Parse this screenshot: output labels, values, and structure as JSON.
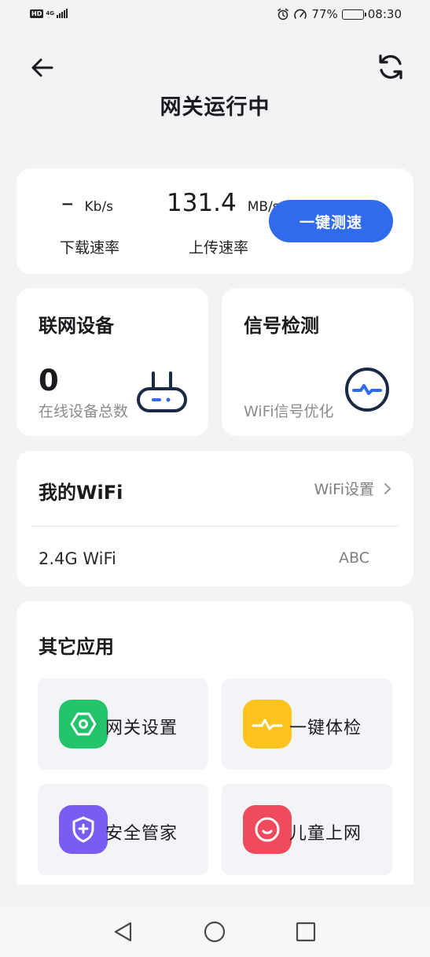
{
  "status_bar": {
    "hd": "HD",
    "network": "4G",
    "battery_percent": "77%",
    "battery_level": 0.77,
    "time": "08:30",
    "icons": [
      "alarm-icon",
      "speedometer-icon"
    ]
  },
  "header": {
    "back_icon": "arrow-left-icon",
    "refresh_icon": "refresh-icon",
    "title": "网关运行中"
  },
  "speed": {
    "download_value": "–",
    "download_unit": "Kb/s",
    "upload_value": "131.4",
    "upload_unit": "MB/s",
    "download_label": "下载速率",
    "upload_label": "上传速率",
    "test_button": "一键测速"
  },
  "devices": {
    "title": "联网设备",
    "count": "0",
    "subtitle": "在线设备总数",
    "icon": "router-icon"
  },
  "signal": {
    "title": "信号检测",
    "subtitle": "WiFi信号优化",
    "icon": "pulse-icon"
  },
  "wifi": {
    "title": "我的WiFi",
    "settings_label": "WiFi设置",
    "band": "2.4G WiFi",
    "ssid": "ABC"
  },
  "apps": {
    "title": "其它应用",
    "items": [
      {
        "label": "网关设置",
        "icon": "hexagon-settings-icon",
        "color": "#22c36b"
      },
      {
        "label": "一键体检",
        "icon": "pulse-icon",
        "color": "#fbc31c"
      },
      {
        "label": "安全管家",
        "icon": "shield-plus-icon",
        "color": "#7a5cf3"
      },
      {
        "label": "儿童上网",
        "icon": "smile-icon",
        "color": "#f04a5d"
      }
    ]
  },
  "colors": {
    "accent": "#2f6bea",
    "background": "#f2f3f5"
  }
}
